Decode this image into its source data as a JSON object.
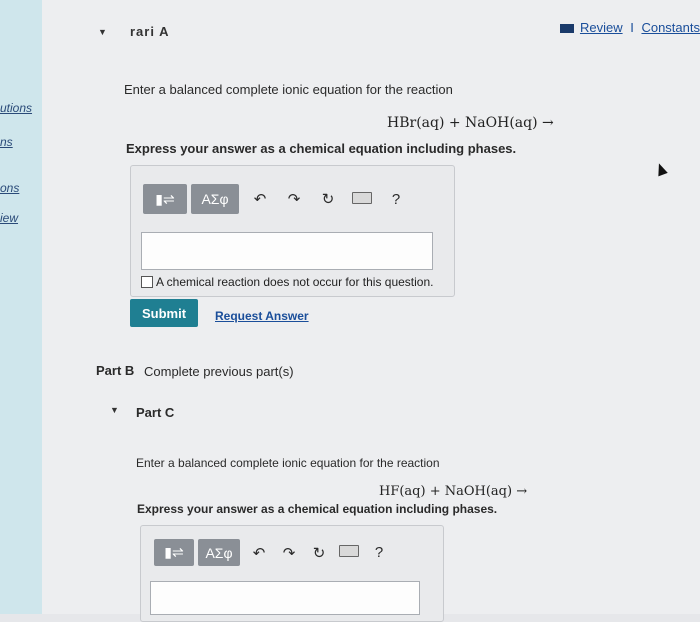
{
  "sidebar": {
    "items": [
      {
        "label": "utions"
      },
      {
        "label": "ns"
      },
      {
        "label": "ons"
      },
      {
        "label": "iew"
      }
    ]
  },
  "header": {
    "part_a_title": "rari A",
    "review_label": "Review",
    "separator": "I",
    "constants_label": "Constants"
  },
  "part_a": {
    "prompt": "Enter a balanced complete ionic equation for the reaction",
    "reaction": "HBr(aq) + NaOH(aq) →",
    "instruction": "Express your answer as a chemical equation including phases.",
    "toolbar": {
      "templates_icon": "▮⇌",
      "greek_label": "ΑΣφ",
      "undo_glyph": "↶",
      "redo_glyph": "↷",
      "reset_glyph": "↻",
      "help_glyph": "?"
    },
    "answer_value": "",
    "no_reaction_label": "A chemical reaction does not occur for this question.",
    "submit_label": "Submit",
    "request_answer_label": "Request Answer"
  },
  "part_b": {
    "label": "Part B",
    "status": "Complete previous part(s)"
  },
  "part_c": {
    "label": "Part C",
    "prompt": "Enter a balanced complete ionic equation for the reaction",
    "reaction": "HF(aq) + NaOH(aq) →",
    "instruction": "Express your answer as a chemical equation including phases.",
    "toolbar": {
      "templates_icon": "▮⇌",
      "greek_label": "ΑΣφ",
      "undo_glyph": "↶",
      "redo_glyph": "↷",
      "reset_glyph": "↻",
      "help_glyph": "?"
    },
    "answer_value": ""
  },
  "colors": {
    "submit": "#1f7f92",
    "link": "#1a4e9a",
    "sidebar": "#cfe6ec"
  }
}
